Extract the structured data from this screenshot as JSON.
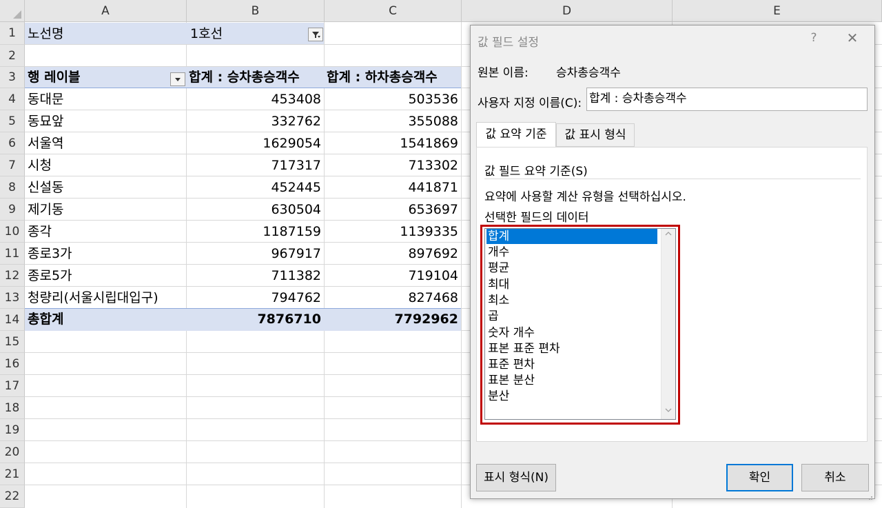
{
  "columns": [
    "A",
    "B",
    "C",
    "D",
    "E"
  ],
  "rows": [
    "1",
    "2",
    "3",
    "4",
    "5",
    "6",
    "7",
    "8",
    "9",
    "10",
    "11",
    "12",
    "13",
    "14",
    "15",
    "16",
    "17",
    "18",
    "19",
    "20",
    "21",
    "22"
  ],
  "filter": {
    "label": "노선명",
    "value": "1호선"
  },
  "pivot": {
    "header": {
      "row_label": "행 레이블",
      "col_b": "합계 : 승차총승객수",
      "col_c": "합계 : 하차총승객수"
    },
    "rows": [
      {
        "name": "동대문",
        "b": "453408",
        "c": "503536"
      },
      {
        "name": "동묘앞",
        "b": "332762",
        "c": "355088"
      },
      {
        "name": "서울역",
        "b": "1629054",
        "c": "1541869"
      },
      {
        "name": "시청",
        "b": "717317",
        "c": "713302"
      },
      {
        "name": "신설동",
        "b": "452445",
        "c": "441871"
      },
      {
        "name": "제기동",
        "b": "630504",
        "c": "653697"
      },
      {
        "name": "종각",
        "b": "1187159",
        "c": "1139335"
      },
      {
        "name": "종로3가",
        "b": "967917",
        "c": "897692"
      },
      {
        "name": "종로5가",
        "b": "711382",
        "c": "719104"
      },
      {
        "name": "청량리(서울시립대입구)",
        "b": "794762",
        "c": "827468"
      }
    ],
    "total": {
      "name": "총합계",
      "b": "7876710",
      "c": "7792962"
    }
  },
  "dialog": {
    "title": "값 필드 설정",
    "help": "?",
    "close": "✕",
    "source_label": "원본 이름:",
    "source_value": "승차총승객수",
    "custom_label": "사용자 지정 이름(C):",
    "custom_value": "합계 : 승차총승객수",
    "tabs": [
      "값 요약 기준",
      "값 표시 형식"
    ],
    "section_title": "값 필드 요약 기준(S)",
    "instruction": "요약에 사용할 계산 유형을 선택하십시오.",
    "data_label": "선택한 필드의 데이터",
    "list_items": [
      "합계",
      "개수",
      "평균",
      "최대",
      "최소",
      "곱",
      "숫자 개수",
      "표본 표준 편차",
      "표준 편차",
      "표본 분산",
      "분산"
    ],
    "selected_index": 0,
    "number_format_button": "표시 형식(N)",
    "ok_button": "확인",
    "cancel_button": "취소"
  },
  "colors": {
    "accent": "#0078d7",
    "highlight_box": "#c00000",
    "pivot_band": "#d9e1f2"
  },
  "icons": {
    "filter": "filter-icon",
    "dropdown": "dropdown-arrow-icon"
  }
}
